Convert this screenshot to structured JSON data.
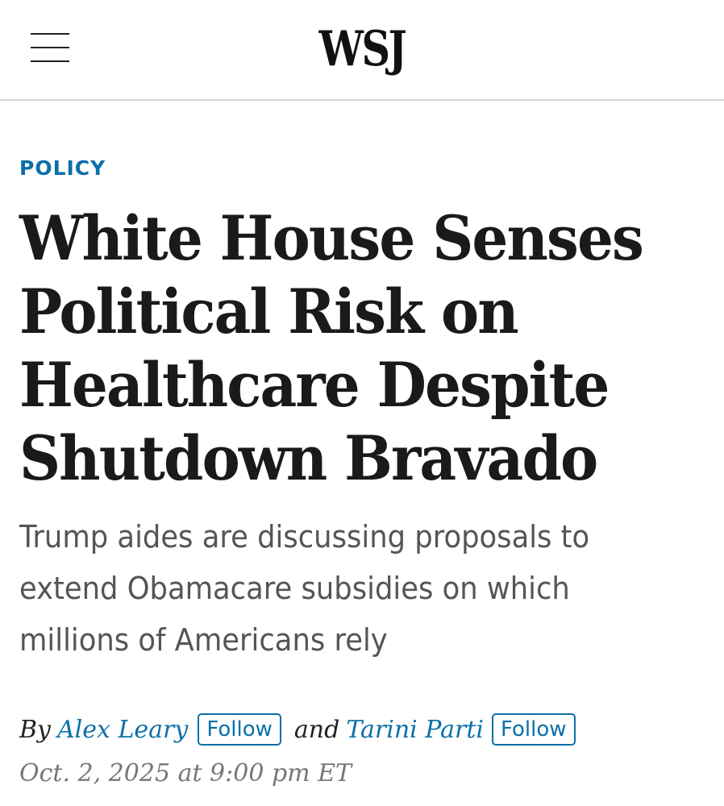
{
  "header": {
    "logo": "WSJ",
    "menu_icon": "hamburger-menu-icon"
  },
  "article": {
    "section": "POLICY",
    "headline": "White House Senses Political Risk on Healthcare Despite Shutdown Bravado",
    "dek": "Trump aides are discussing proposals to extend Obamacare subsidies on which millions of Americans rely",
    "byline": {
      "prefix": "By",
      "author1": "Alex Leary",
      "follow1": "Follow",
      "conjunction": "and",
      "author2": "Tarini Parti",
      "follow2": "Follow"
    },
    "date": "Oct. 2, 2025 at 9:00 pm ET"
  },
  "colors": {
    "accent": "#0b6fa8",
    "headline": "#1a1a1a",
    "dek": "#555555",
    "date": "#777777"
  }
}
